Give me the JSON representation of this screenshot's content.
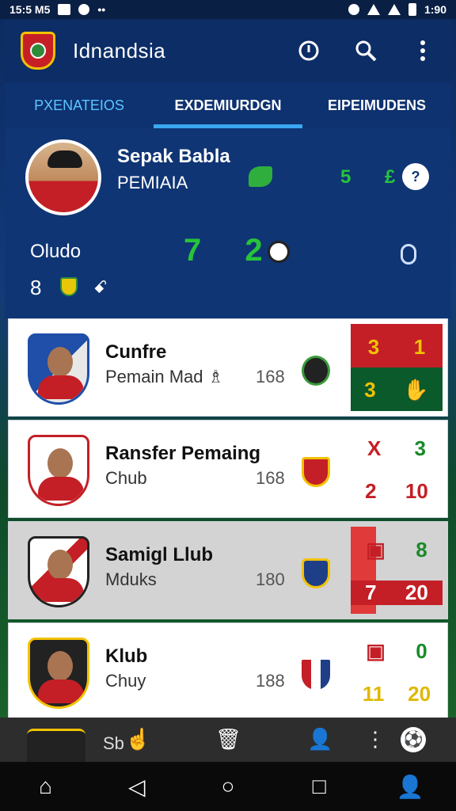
{
  "status_bar": {
    "time_left": "15:5 M5",
    "time_right": "1:90",
    "icons": [
      "mail-icon",
      "chat-icon",
      "more-icon",
      "alarm-icon",
      "wifi-icon",
      "signal-icon",
      "battery-icon"
    ]
  },
  "app_bar": {
    "title": "Idnandsia",
    "actions": [
      "info-icon",
      "search-icon",
      "more-vert-icon"
    ]
  },
  "tabs": [
    {
      "label": "PXENATEIOS",
      "active": false
    },
    {
      "label": "EXDEMIURDGN",
      "active": true
    },
    {
      "label": "EIPEIMUDENS",
      "active": false
    }
  ],
  "profile": {
    "name": "Sepak Babla",
    "subtitle": "PEMIAIA",
    "stats": "5 £",
    "help_label": "?",
    "club_label": "Oludo",
    "score": "7 2",
    "small_number": "8",
    "link_icon": "ꗃ"
  },
  "clubs": [
    {
      "title": "Cunfre",
      "subtitle": "Pemain Mad ♗",
      "number": "168",
      "score_top": [
        "3",
        "1"
      ],
      "score_bottom": [
        "3",
        "✋"
      ],
      "top_colors": [
        "#f2c200",
        "#f2c200"
      ],
      "bottom_colors": [
        "#f2c200",
        "#ffffff"
      ]
    },
    {
      "title": "Ransfer Pemaing",
      "subtitle": "Chub",
      "number": "168",
      "score_top": [
        "X",
        "3"
      ],
      "score_bottom": [
        "2",
        "10"
      ],
      "top_colors": [
        "#c41f26",
        "#1a8a2a"
      ],
      "bottom_colors": [
        "#c41f26",
        "#c41f26"
      ]
    },
    {
      "title": "Samigl Llub",
      "subtitle": "Mduks",
      "number": "180",
      "score_top": [
        "▣",
        "8"
      ],
      "score_bottom": [
        "7",
        "20"
      ],
      "top_colors": [
        "#c41f26",
        "#1a8a2a"
      ],
      "bottom_colors": [
        "#ffffff",
        "#ffffff"
      ]
    },
    {
      "title": "Klub",
      "subtitle": "Chuy",
      "number": "188",
      "score_top": [
        "▣",
        "0"
      ],
      "score_bottom": [
        "11",
        "20"
      ],
      "top_colors": [
        "#c41f26",
        "#1a8a2a"
      ],
      "bottom_colors": [
        "#e0b800",
        "#e0b800"
      ]
    }
  ],
  "bottom_tabs": {
    "partial_text": "Sb",
    "icons": [
      "hand-icon",
      "trash-icon",
      "user-icon",
      "dots-icon",
      "ball-icon"
    ]
  },
  "nav_bar": [
    "home-icon",
    "back-icon",
    "home-circle-icon",
    "recents-icon",
    "profile-icon"
  ]
}
